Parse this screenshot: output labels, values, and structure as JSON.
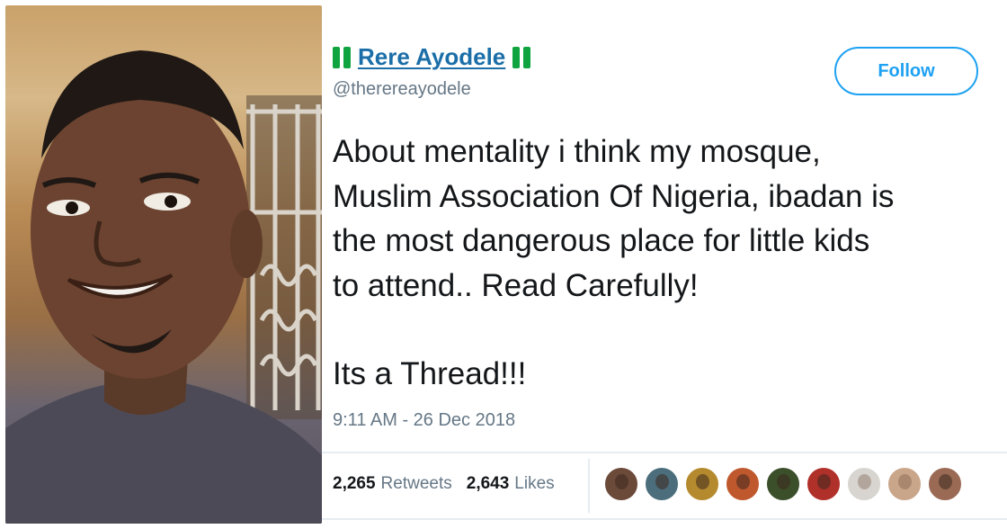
{
  "profile": {
    "display_name": "Rere Ayodele",
    "handle": "@therereayodele",
    "follow_label": "Follow",
    "accent_color": "#1da1f2",
    "name_color": "#1b6ea8",
    "flag_icons": [
      "nigeria-flag-icon",
      "nigeria-flag-icon"
    ]
  },
  "tweet": {
    "lines": [
      "About mentality i think my mosque,",
      "Muslim Association Of Nigeria, ibadan is",
      "the most dangerous place for little kids",
      "to attend.. Read Carefully!"
    ],
    "closing": "Its a Thread!!!",
    "timestamp": "9:11 AM - 26 Dec 2018"
  },
  "stats": {
    "retweets_count": "2,265",
    "retweets_label": "Retweets",
    "likes_count": "2,643",
    "likes_label": "Likes"
  },
  "liked_by_avatars": [
    {
      "color": "#6b4a3a"
    },
    {
      "color": "#4c6e7c"
    },
    {
      "color": "#b58a2e"
    },
    {
      "color": "#c0582e"
    },
    {
      "color": "#3b4f2a"
    },
    {
      "color": "#b0302a"
    },
    {
      "color": "#d8d4cf",
      "tone": "light"
    },
    {
      "color": "#c9a58a",
      "tone": "light"
    },
    {
      "color": "#9a6a55"
    }
  ]
}
